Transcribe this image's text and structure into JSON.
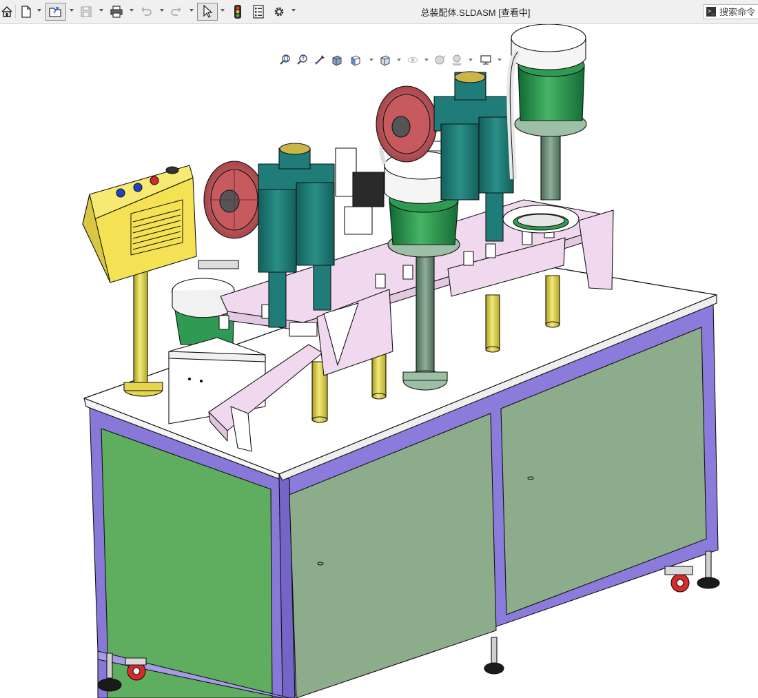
{
  "window": {
    "title": "总装配体.SLDASM [查看中]"
  },
  "toolbar": {
    "buttons": [
      {
        "name": "home-button",
        "icon": "home-icon"
      },
      {
        "name": "new-document-button",
        "icon": "new-document-icon"
      },
      {
        "name": "open-button",
        "icon": "open-folder-icon"
      },
      {
        "name": "save-button",
        "icon": "save-icon"
      },
      {
        "name": "print-button",
        "icon": "printer-icon"
      },
      {
        "name": "undo-button",
        "icon": "undo-icon"
      },
      {
        "name": "redo-button",
        "icon": "redo-icon"
      },
      {
        "name": "select-button",
        "icon": "cursor-arrow-icon"
      },
      {
        "name": "rebuild-button",
        "icon": "traffic-light-icon"
      },
      {
        "name": "file-properties-button",
        "icon": "file-properties-icon"
      },
      {
        "name": "options-button",
        "icon": "gear-icon"
      }
    ]
  },
  "search": {
    "placeholder": "搜索命令"
  },
  "view_toolbar": {
    "icons": [
      "zoom-to-fit-icon",
      "zoom-to-area-icon",
      "previous-view-icon",
      "section-view-icon",
      "view-orientation-icon",
      "display-style-icon",
      "hide-show-items-icon",
      "edit-appearance-icon",
      "apply-scene-icon",
      "view-settings-icon"
    ]
  },
  "colors": {
    "frame": "#8878d8",
    "panel_green": "#5fae5f",
    "panel_grey_green": "#8cac8c",
    "tabletop": "#ffffff",
    "mechanism": "#f0d8ef",
    "cylinder_teal": "#1f7c78",
    "pulley": "#c65a5f",
    "bowl_green": "#2f9b52",
    "brass": "#e4d54f",
    "control_box": "#f4e254",
    "caster_red": "#d82a2a"
  }
}
